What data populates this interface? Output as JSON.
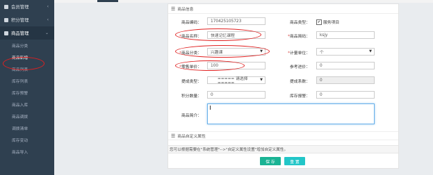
{
  "sidebar": {
    "groups": [
      {
        "label": "会员管理"
      },
      {
        "label": "积分管理"
      },
      {
        "label": "商品管理"
      }
    ],
    "items": [
      "商品分类",
      "商品新增",
      "商品列表",
      "库存列表",
      "库存预警",
      "商品入库",
      "商品调拨",
      "调拨清单",
      "库存变动",
      "商品导入"
    ]
  },
  "section": {
    "info_title": "商品信息",
    "custom_title": "商品自定义属性"
  },
  "form": {
    "code_label": "商品编码：",
    "code_value": "170425105723",
    "type_label": "商品类型：",
    "service_label": "服务项目",
    "name_label": "商品名称：",
    "name_value": "快速记忆课程",
    "shortcode_label": "商品简码：",
    "shortcode_value": "ksjy",
    "category_label": "商品分类：",
    "category_value": "兴趣课",
    "unit_label": "计量单位：",
    "unit_value": "个",
    "price_label": "零售单价：",
    "price_value": "100",
    "cost_label": "参考进价：",
    "cost_value": "0",
    "commission_type_label": "提成类型：",
    "commission_type_value": "===== 请选择 =====",
    "commission_rate_label": "提成系数：",
    "commission_rate_value": "0",
    "points_label": "积分数量：",
    "points_value": "0",
    "stock_warn_label": "库存报警：",
    "stock_warn_value": "0",
    "desc_label": "商品简介："
  },
  "hint": "您可以根据需要在\"系统管理\"-->\"自定义属性设置\"增加自定义属性。",
  "buttons": {
    "save": "保 存",
    "reset": "重 置"
  },
  "colors": {
    "sidebar": "#2f4050",
    "annotation": "#e02020",
    "save": "#1ab394",
    "reset": "#23c6c8"
  }
}
